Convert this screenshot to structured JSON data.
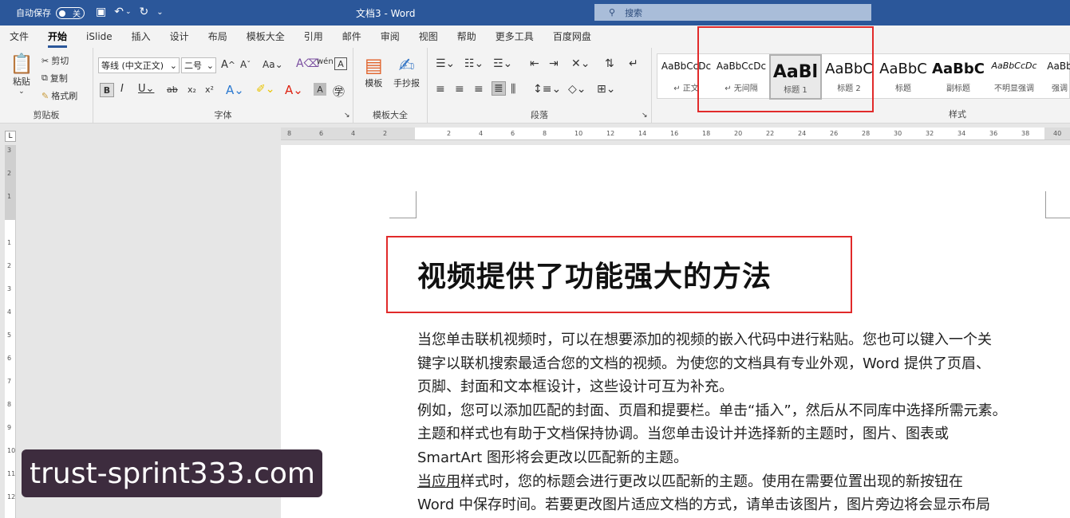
{
  "titlebar": {
    "autosave_label": "自动保存",
    "autosave_state": "关",
    "doc_title": "文档3  -  Word",
    "search_placeholder": "搜索",
    "quick_icons": [
      "save-icon",
      "undo-icon",
      "redo-icon",
      "customize-icon"
    ]
  },
  "tabs": [
    "文件",
    "开始",
    "iSlide",
    "插入",
    "设计",
    "布局",
    "模板大全",
    "引用",
    "邮件",
    "审阅",
    "视图",
    "帮助",
    "更多工具",
    "百度网盘"
  ],
  "active_tab": "开始",
  "clipboard": {
    "paste": "粘贴",
    "cut": "剪切",
    "copy": "复制",
    "format_painter": "格式刷",
    "group": "剪贴板"
  },
  "font": {
    "name": "等线 (中文正文)",
    "size": "二号",
    "group": "字体",
    "bold": "B",
    "italic": "I",
    "underline": "U",
    "strike": "ab",
    "sub": "x₂",
    "sup": "x²"
  },
  "template": {
    "templates": "模板",
    "sketch": "手抄报",
    "group": "模板大全"
  },
  "paragraph": {
    "group": "段落"
  },
  "styles": {
    "group": "样式",
    "items": [
      {
        "preview": "AaBbCcDc",
        "name": "↵ 正文"
      },
      {
        "preview": "AaBbCcDc",
        "name": "↵ 无间隔"
      },
      {
        "preview": "AaBl",
        "name": "标题 1"
      },
      {
        "preview": "AaBbC",
        "name": "标题 2"
      },
      {
        "preview": "AaBbC",
        "name": "标题"
      },
      {
        "preview": "AaBbC",
        "name": "副标题"
      },
      {
        "preview": "AaBbCcDc",
        "name": "不明显强调"
      },
      {
        "preview": "AaBb",
        "name": "强调"
      }
    ]
  },
  "ruler": {
    "labels": [
      "8",
      "6",
      "4",
      "2",
      "",
      "2",
      "4",
      "6",
      "8",
      "10",
      "12",
      "14",
      "16",
      "18",
      "20",
      "22",
      "24",
      "26",
      "28",
      "30",
      "32",
      "34",
      "36",
      "38",
      "40"
    ]
  },
  "vruler": {
    "labels": [
      "3",
      "2",
      "1",
      "",
      "1",
      "2",
      "3",
      "4",
      "5",
      "6",
      "7",
      "8",
      "9",
      "10",
      "11",
      "12"
    ]
  },
  "document": {
    "title": "视频提供了功能强大的方法",
    "lines": [
      "当您单击联机视频时，可以在想要添加的视频的嵌入代码中进行粘贴。您也可以键入一个关",
      "键字以联机搜索最适合您的文档的视频。为使您的文档具有专业外观，Word 提供了页眉、",
      "页脚、封面和文本框设计，这些设计可互为补充。",
      "例如，您可以添加匹配的封面、页眉和提要栏。单击“插入”，然后从不同库中选择所需元素。",
      "主题和样式也有助于文档保持协调。当您单击设计并选择新的主题时，图片、图表或",
      "SmartArt 图形将会更改以匹配新的主题。",
      "样式时，您的标题会进行更改以匹配新的主题。使用在需要位置出现的新按钮在",
      "Word 中保存时间。若要更改图片适应文档的方式，请单击该图片，图片旁边将会显示布局"
    ],
    "underlined_prefix": "当应用"
  },
  "watermark": "trust-sprint333.com",
  "colors": {
    "accent": "#2b579a",
    "highlight_box": "#e12a2a"
  }
}
